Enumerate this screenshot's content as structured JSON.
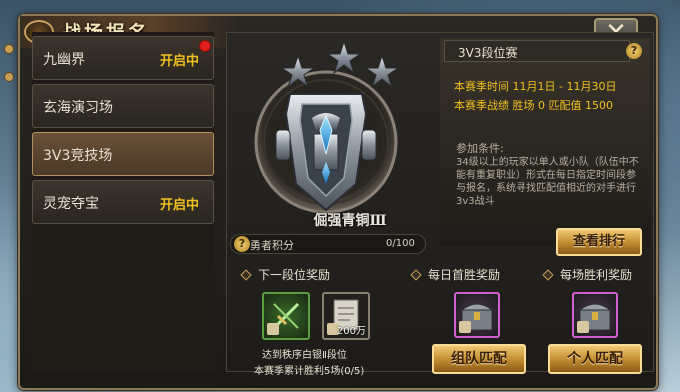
{
  "window": {
    "title": "战场报名",
    "close_glyph": "✕"
  },
  "menu": {
    "items": [
      {
        "label": "九幽界",
        "status": "开启中",
        "has_dot": true,
        "active": false
      },
      {
        "label": "玄海演习场",
        "status": "",
        "has_dot": false,
        "active": false
      },
      {
        "label": "3V3竞技场",
        "status": "",
        "has_dot": false,
        "active": true
      },
      {
        "label": "灵宠夺宝",
        "status": "开启中",
        "has_dot": false,
        "active": false
      }
    ]
  },
  "rank": {
    "name": "倔强青铜Ⅲ",
    "progress_label": "勇者积分",
    "progress_value": "0/100",
    "progress_fraction": 0
  },
  "info": {
    "mode": "3V3段位赛",
    "season_time": "本赛季时间 11月1日 - 11月30日",
    "season_record": "本赛季战绩 胜场 0 匹配值 1500",
    "cond_title": "参加条件:",
    "cond_text": "34级以上的玩家以单人或小队（队伍中不能有重复职业）形式在每日指定时间段参与报名，系统寻找匹配值相近的对手进行3v3战斗",
    "view_rank_button": "查看排行"
  },
  "rewards": {
    "next_rank_title": "下一段位奖励",
    "daily_first_title": "每日首胜奖励",
    "per_win_title": "每场胜利奖励",
    "item_count": "200万",
    "target_rank": "达到秩序白银Ⅱ段位",
    "season_wins": "本赛季累计胜利5场(0/5)",
    "team_match_button": "组队匹配",
    "solo_match_button": "个人匹配"
  },
  "colors": {
    "accent_gold": "#f0c020",
    "button_gold": "#e0b050",
    "alert_red": "#e0201a"
  }
}
